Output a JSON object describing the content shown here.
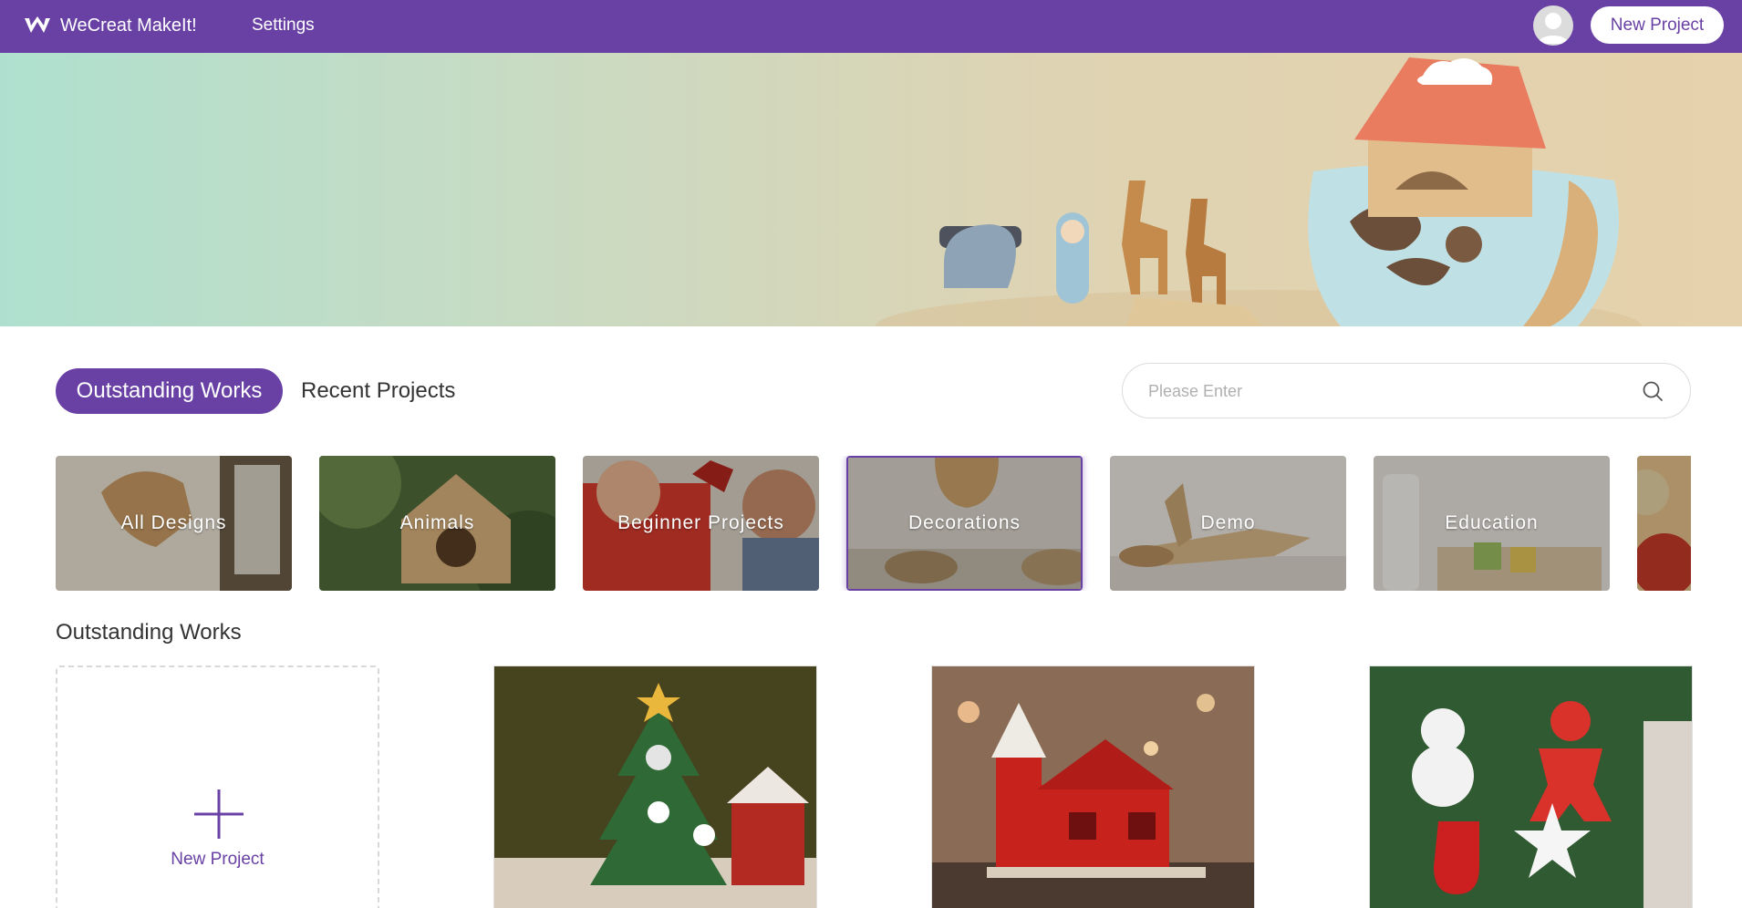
{
  "header": {
    "app_title": "WeCreat MakeIt!",
    "settings_label": "Settings",
    "new_project_label": "New Project",
    "brand_color": "#6941a5"
  },
  "tabs": {
    "active_label": "Outstanding Works",
    "recent_label": "Recent Projects"
  },
  "search": {
    "placeholder": "Please Enter",
    "icon": "search-icon"
  },
  "categories": [
    {
      "label": "All Designs"
    },
    {
      "label": "Animals"
    },
    {
      "label": "Beginner Projects"
    },
    {
      "label": "Decorations",
      "selected": true
    },
    {
      "label": "Demo"
    },
    {
      "label": "Education"
    }
  ],
  "works": {
    "section_title": "Outstanding Works",
    "new_card_label": "New Project"
  }
}
